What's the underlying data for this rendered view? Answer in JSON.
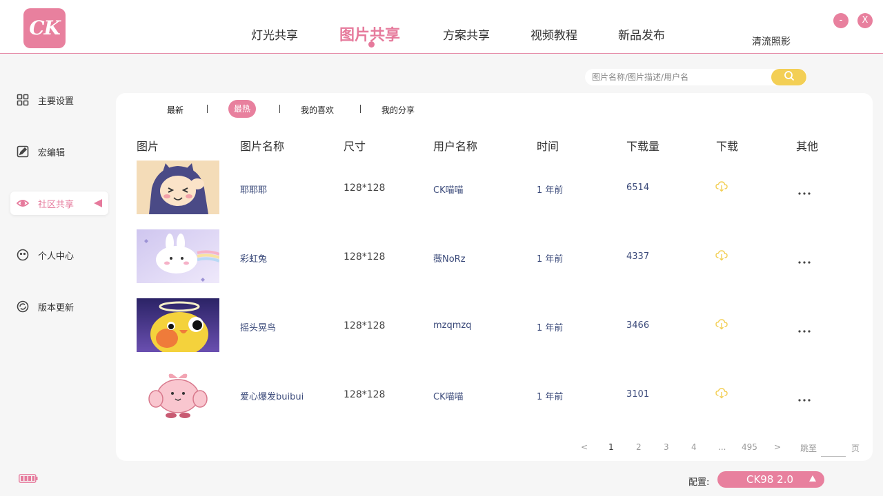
{
  "app": {
    "logo_text": "CK",
    "user_name": "清流照影",
    "minimize_label": "-",
    "close_label": "X",
    "accent_color": "#e8809e",
    "highlight_color": "#f3cf55"
  },
  "nav": {
    "items": [
      {
        "label": "灯光共享"
      },
      {
        "label": "图片共享",
        "active": true
      },
      {
        "label": "方案共享"
      },
      {
        "label": "视频教程"
      },
      {
        "label": "新品发布"
      }
    ]
  },
  "sidebar": {
    "items": [
      {
        "label": "主要设置",
        "icon": "grid-icon"
      },
      {
        "label": "宏编辑",
        "icon": "edit-icon"
      },
      {
        "label": "社区共享",
        "icon": "share-eye-icon",
        "active": true
      },
      {
        "label": "个人中心",
        "icon": "smile-icon"
      },
      {
        "label": "版本更新",
        "icon": "refresh-icon"
      }
    ]
  },
  "search": {
    "placeholder": "图片名称/图片描述/用户名",
    "value": ""
  },
  "tabs": [
    {
      "label": "最新"
    },
    {
      "label": "最热",
      "active": true
    },
    {
      "label": "我的喜欢"
    },
    {
      "label": "我的分享"
    }
  ],
  "table": {
    "columns": [
      "图片",
      "图片名称",
      "尺寸",
      "用户名称",
      "时间",
      "下载量",
      "下载",
      "其他"
    ],
    "rows": [
      {
        "name": "耶耶耶",
        "size": "128*128",
        "user": "CK喵喵",
        "time": "1 年前",
        "downloads": "6514",
        "thumb": "hooded-cat"
      },
      {
        "name": "彩虹兔",
        "size": "128*128",
        "user": "薇NoRz",
        "time": "1 年前",
        "downloads": "4337",
        "thumb": "rainbow-bunny"
      },
      {
        "name": "摇头晃鸟",
        "size": "128*128",
        "user": "mzqmzq",
        "time": "1 年前",
        "downloads": "3466",
        "thumb": "angel-bird"
      },
      {
        "name": "爱心爆发buibui",
        "size": "128*128",
        "user": "CK喵喵",
        "time": "1 年前",
        "downloads": "3101",
        "thumb": "pink-blob"
      }
    ]
  },
  "pagination": {
    "prev": "<",
    "pages": [
      "1",
      "2",
      "3",
      "4"
    ],
    "ellipsis": "...",
    "last": "495",
    "next": ">",
    "jump_label": "跳至",
    "jump_value": "",
    "page_suffix": "页",
    "current": 1
  },
  "footer": {
    "config_label": "配置:",
    "config_value": "CK98 2.0"
  }
}
